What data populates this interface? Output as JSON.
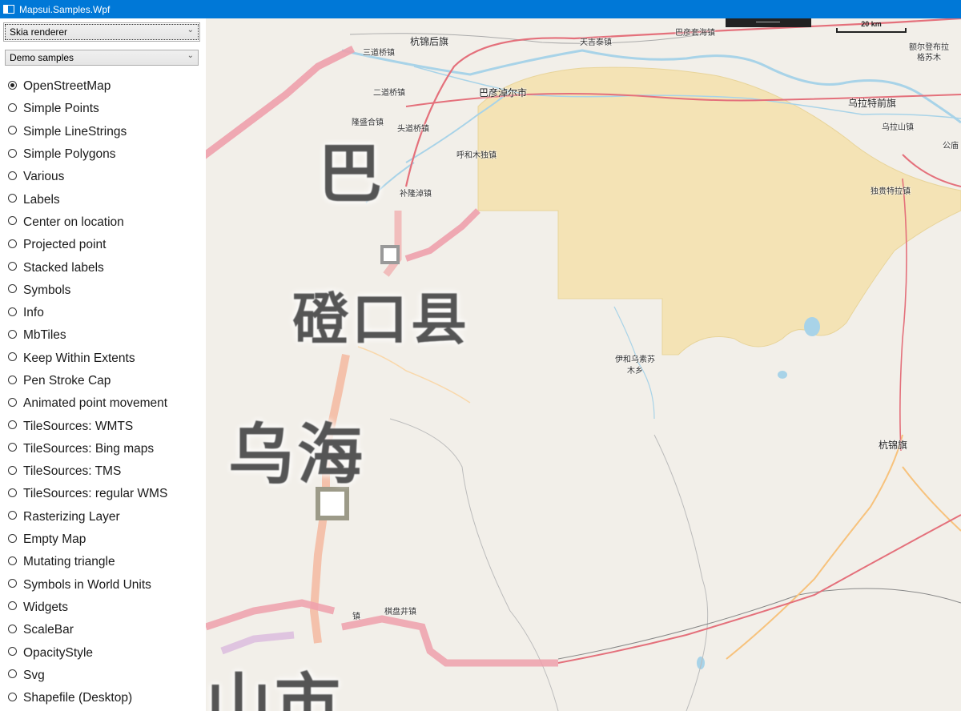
{
  "window": {
    "title": "Mapsui.Samples.Wpf"
  },
  "renderer_select": {
    "value": "Skia renderer"
  },
  "category_select": {
    "value": "Demo samples"
  },
  "samples": [
    {
      "label": "OpenStreetMap",
      "checked": true
    },
    {
      "label": "Simple Points",
      "checked": false
    },
    {
      "label": "Simple LineStrings",
      "checked": false
    },
    {
      "label": "Simple Polygons",
      "checked": false
    },
    {
      "label": "Various",
      "checked": false
    },
    {
      "label": "Labels",
      "checked": false
    },
    {
      "label": "Center on location",
      "checked": false
    },
    {
      "label": "Projected point",
      "checked": false
    },
    {
      "label": "Stacked labels",
      "checked": false
    },
    {
      "label": "Symbols",
      "checked": false
    },
    {
      "label": "Info",
      "checked": false
    },
    {
      "label": "MbTiles",
      "checked": false
    },
    {
      "label": "Keep Within Extents",
      "checked": false
    },
    {
      "label": "Pen Stroke Cap",
      "checked": false
    },
    {
      "label": "Animated point movement",
      "checked": false
    },
    {
      "label": "TileSources: WMTS",
      "checked": false
    },
    {
      "label": "TileSources: Bing maps",
      "checked": false
    },
    {
      "label": "TileSources: TMS",
      "checked": false
    },
    {
      "label": "TileSources: regular WMS",
      "checked": false
    },
    {
      "label": "Rasterizing Layer",
      "checked": false
    },
    {
      "label": "Empty Map",
      "checked": false
    },
    {
      "label": "Mutating triangle",
      "checked": false
    },
    {
      "label": "Symbols in World Units",
      "checked": false
    },
    {
      "label": "Widgets",
      "checked": false
    },
    {
      "label": "ScaleBar",
      "checked": false
    },
    {
      "label": "OpacityStyle",
      "checked": false
    },
    {
      "label": "Svg",
      "checked": false
    },
    {
      "label": "Shapefile (Desktop)",
      "checked": false
    }
  ],
  "scalebar": {
    "label": "20 km"
  },
  "map_labels": {
    "hangjin_houqi": "杭锦后旗",
    "tianjitai": "天吉泰镇",
    "batao_hai": "巴彦套海镇",
    "sandao_qiao": "三道桥镇",
    "erdao_qiao": "二道桥镇",
    "bayannaoer": "巴彦淖尔市",
    "longsheng_he": "隆盛合镇",
    "toudao_qiao": "头道桥镇",
    "huhemudu": "呼和木独镇",
    "bulong_nao": "补隆淖镇",
    "eerdeng_bule": "额尔登布拉格苏木",
    "wulate_qianqi": "乌拉特前旗",
    "wulashan": "乌拉山镇",
    "gongmiao": "公庙",
    "dugui_tela": "独贵特拉镇",
    "yihe_wusu": "伊和乌素苏",
    "yihe_wusu_2": "木乡",
    "hangjin_qi": "杭锦旗",
    "qipan_jing": "棋盘井镇",
    "zhen": "镇",
    "big_bayan": "巴",
    "big_dengkou": "磴口县",
    "big_wuhai": "乌海",
    "big_shi": "山市"
  }
}
